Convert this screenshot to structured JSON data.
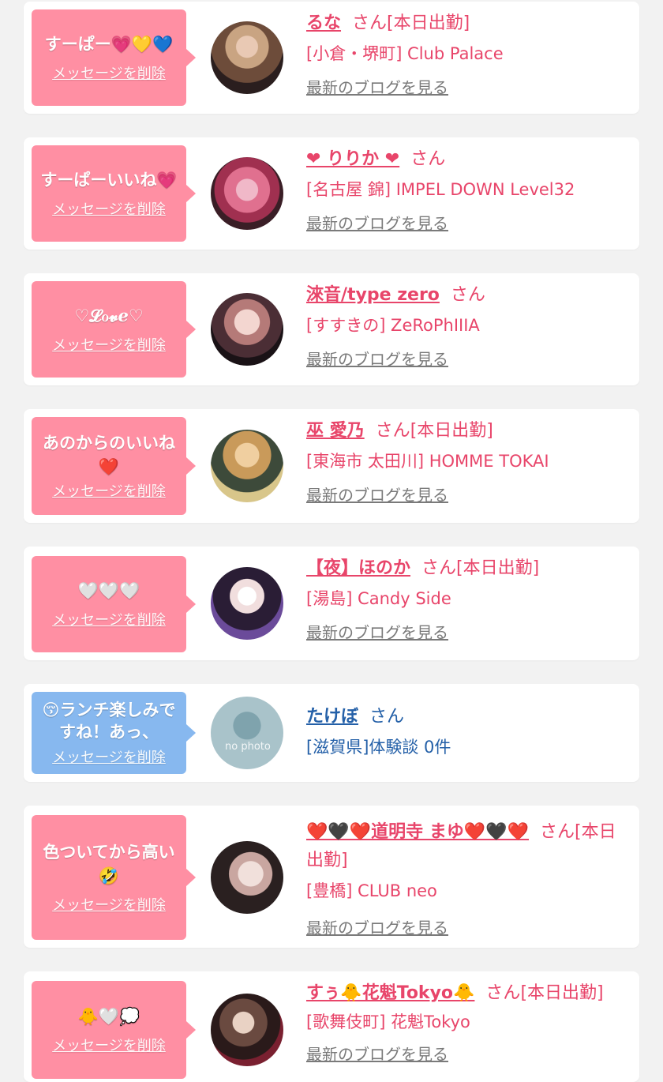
{
  "delete_label": "メッセージを削除",
  "blog_label": "最新のブログを見る",
  "items": [
    {
      "message": "すーぱー💗💛💙",
      "name": "るな",
      "honorific": "さん",
      "badge": "[本日出勤]",
      "shop": "[小倉・堺町] Club Palace",
      "blog": "最新のブログを見る",
      "theme": "pink"
    },
    {
      "message": "すーぱーいいね💗",
      "name": "❤ りりか ❤",
      "honorific": "さん",
      "badge": "",
      "shop": "[名古屋 錦] IMPEL DOWN Level32",
      "blog": "最新のブログを見る",
      "theme": "pink"
    },
    {
      "message": "♡𝓛ℴ𝓿ℯ♡",
      "name": "淶音/type zero",
      "honorific": "さん",
      "badge": "",
      "shop": "[すすきの] ZeRoPhIIIA",
      "blog": "最新のブログを見る",
      "theme": "pink"
    },
    {
      "message": "あのからのいいね❤️",
      "name": "巫 愛乃",
      "honorific": "さん",
      "badge": "[本日出勤]",
      "shop": "[東海市 太田川] HOMME TOKAI",
      "blog": "最新のブログを見る",
      "theme": "pink"
    },
    {
      "message": "🤍🤍🤍",
      "name": "【夜】ほのか",
      "honorific": "さん",
      "badge": "[本日出勤]",
      "shop": "[湯島] Candy Side",
      "blog": "最新のブログを見る",
      "theme": "pink"
    },
    {
      "message": "😚ランチ楽しみですね！あっ、",
      "name": "たけぼ",
      "honorific": "さん",
      "badge": "",
      "shop": "[滋賀県]体験談 0件",
      "blog": "",
      "avatar_text": "no photo",
      "theme": "blue"
    },
    {
      "message": "色ついてから高い🤣",
      "name": "❤️🖤❤️道明寺 まゆ❤️🖤❤️",
      "honorific": "さん",
      "badge": "[本日出勤]",
      "shop": "[豊橋] CLUB neo",
      "blog": "最新のブログを見る",
      "theme": "pink"
    },
    {
      "message": "🐥🤍💭",
      "name": "すぅ🐥花魁Tokyo🐥",
      "honorific": "さん",
      "badge": "[本日出勤]",
      "shop": "[歌舞伎町] 花魁Tokyo",
      "blog": "最新のブログを見る",
      "theme": "pink"
    }
  ],
  "colors": {
    "pink_bubble": "#ff8fa3",
    "blue_bubble": "#87b8ef",
    "pink_text": "#e8456a",
    "blue_text": "#2460a8",
    "page_bg": "#f2f2f2"
  }
}
